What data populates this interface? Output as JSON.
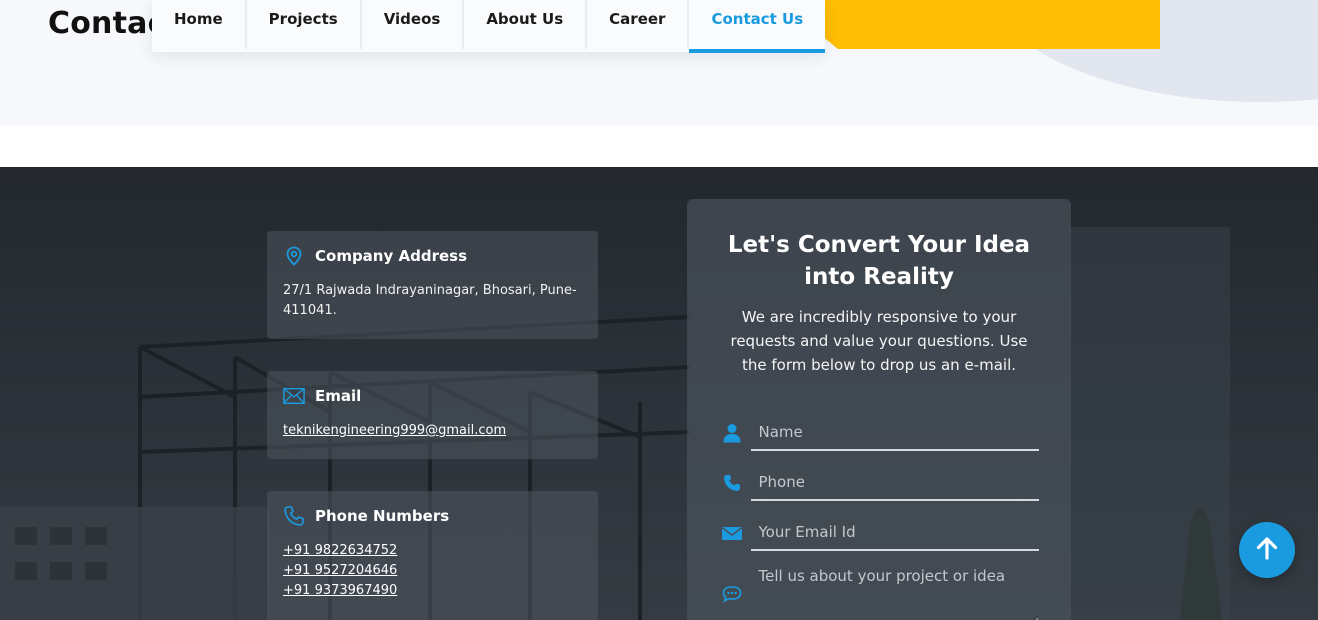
{
  "header": {
    "page_title": "Contact",
    "nav": [
      {
        "label": "Home"
      },
      {
        "label": "Projects"
      },
      {
        "label": "Videos"
      },
      {
        "label": "About Us"
      },
      {
        "label": "Career"
      },
      {
        "label": "Contact Us",
        "active": true
      }
    ]
  },
  "contact_info": {
    "address": {
      "icon": "location-pin-icon",
      "title": "Company Address",
      "text": "27/1 Rajwada Indrayaninagar, Bhosari, Pune-411041."
    },
    "email": {
      "icon": "envelope-icon",
      "title": "Email",
      "value": "teknikengineering999@gmail.com"
    },
    "phones": {
      "icon": "phone-icon",
      "title": "Phone Numbers",
      "numbers": [
        "+91 9822634752",
        "+91 9527204646",
        "+91 9373967490"
      ]
    }
  },
  "form": {
    "title": "Let's Convert Your Idea into Reality",
    "subtitle": "We are incredibly responsive to your requests and value your questions. Use the form below to drop us an e-mail.",
    "fields": {
      "name": {
        "icon": "user-icon",
        "placeholder": "Name",
        "value": ""
      },
      "phone": {
        "icon": "phone-icon",
        "placeholder": "Phone",
        "value": ""
      },
      "email": {
        "icon": "envelope-icon",
        "placeholder": "Your Email Id",
        "value": ""
      },
      "message": {
        "icon": "chat-bubble-icon",
        "placeholder": "Tell us about your project or idea",
        "value": ""
      }
    }
  },
  "scroll_top": {
    "icon": "arrow-up-icon"
  },
  "colors": {
    "accent": "#1a9be0",
    "yellow": "#ffbd04",
    "dark_bg": "#2a3138"
  }
}
